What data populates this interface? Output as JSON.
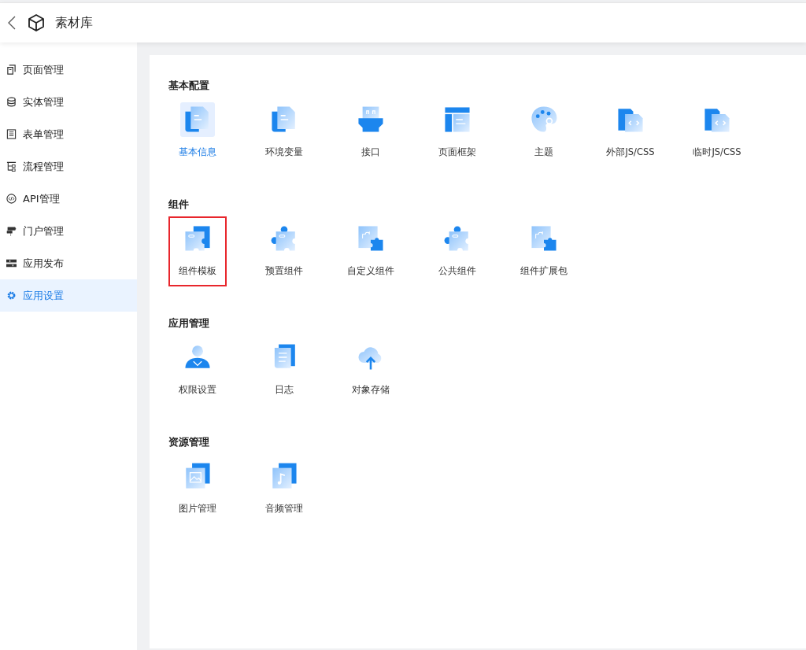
{
  "header": {
    "title": "素材库"
  },
  "sidebar": {
    "items": [
      {
        "label": "页面管理",
        "kind": "pages",
        "selected": false
      },
      {
        "label": "实体管理",
        "kind": "database",
        "selected": false
      },
      {
        "label": "表单管理",
        "kind": "form",
        "selected": false
      },
      {
        "label": "流程管理",
        "kind": "flow",
        "selected": false
      },
      {
        "label": "API管理",
        "kind": "api",
        "selected": false
      },
      {
        "label": "门户管理",
        "kind": "signpost",
        "selected": false
      },
      {
        "label": "应用发布",
        "kind": "publish",
        "selected": false
      },
      {
        "label": "应用设置",
        "kind": "settings",
        "selected": true
      }
    ]
  },
  "sections": [
    {
      "title": "基本配置",
      "items": [
        {
          "label": "基本信息",
          "kind": "document",
          "selected": true,
          "outlined": false
        },
        {
          "label": "环境变量",
          "kind": "document",
          "selected": false,
          "outlined": false
        },
        {
          "label": "接口",
          "kind": "plug",
          "selected": false,
          "outlined": false
        },
        {
          "label": "页面框架",
          "kind": "layout",
          "selected": false,
          "outlined": false
        },
        {
          "label": "主题",
          "kind": "palette",
          "selected": false,
          "outlined": false
        },
        {
          "label": "外部JS/CSS",
          "kind": "code",
          "selected": false,
          "outlined": false
        },
        {
          "label": "临时JS/CSS",
          "kind": "code",
          "selected": false,
          "outlined": false
        }
      ]
    },
    {
      "title": "组件",
      "items": [
        {
          "label": "组件模板",
          "kind": "puzzle-stack",
          "selected": false,
          "outlined": true
        },
        {
          "label": "预置组件",
          "kind": "puzzle",
          "selected": false,
          "outlined": false
        },
        {
          "label": "自定义组件",
          "kind": "puzzle-piece",
          "selected": false,
          "outlined": false
        },
        {
          "label": "公共组件",
          "kind": "puzzle",
          "selected": false,
          "outlined": false
        },
        {
          "label": "组件扩展包",
          "kind": "puzzle-piece",
          "selected": false,
          "outlined": false
        }
      ]
    },
    {
      "title": "应用管理",
      "items": [
        {
          "label": "权限设置",
          "kind": "person",
          "selected": false,
          "outlined": false
        },
        {
          "label": "日志",
          "kind": "scroll",
          "selected": false,
          "outlined": false
        },
        {
          "label": "对象存储",
          "kind": "cloud",
          "selected": false,
          "outlined": false
        }
      ]
    },
    {
      "title": "资源管理",
      "items": [
        {
          "label": "图片管理",
          "kind": "image",
          "selected": false,
          "outlined": false
        },
        {
          "label": "音频管理",
          "kind": "music",
          "selected": false,
          "outlined": false
        }
      ]
    }
  ]
}
